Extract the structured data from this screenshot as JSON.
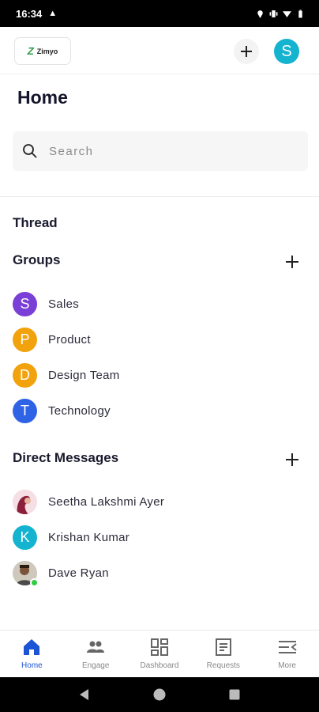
{
  "status_bar": {
    "time": "16:34"
  },
  "header": {
    "logo_text": "Zimyo",
    "profile_initial": "S"
  },
  "page": {
    "title": "Home"
  },
  "search": {
    "placeholder": "Search"
  },
  "thread": {
    "label": "Thread"
  },
  "groups": {
    "label": "Groups",
    "items": [
      {
        "initial": "S",
        "name": "Sales",
        "color": "#7a3fd6"
      },
      {
        "initial": "P",
        "name": "Product",
        "color": "#f2a20c"
      },
      {
        "initial": "D",
        "name": "Design Team",
        "color": "#f2a20c"
      },
      {
        "initial": "T",
        "name": "Technology",
        "color": "#2f63e6"
      }
    ]
  },
  "direct_messages": {
    "label": "Direct Messages",
    "items": [
      {
        "name": "Seetha Lakshmi Ayer"
      },
      {
        "initial": "K",
        "name": "Krishan Kumar",
        "color": "#14b3cf"
      },
      {
        "name": "Dave Ryan",
        "online": true
      }
    ]
  },
  "bottom_nav": {
    "items": [
      {
        "label": "Home",
        "icon": "home-icon",
        "active": true
      },
      {
        "label": "Engage",
        "icon": "people-icon"
      },
      {
        "label": "Dashboard",
        "icon": "dashboard-icon"
      },
      {
        "label": "Requests",
        "icon": "requests-icon"
      },
      {
        "label": "More",
        "icon": "more-icon"
      }
    ]
  },
  "colors": {
    "accent": "#1c54d6",
    "profile": "#14b3cf",
    "online": "#2ecc40"
  }
}
